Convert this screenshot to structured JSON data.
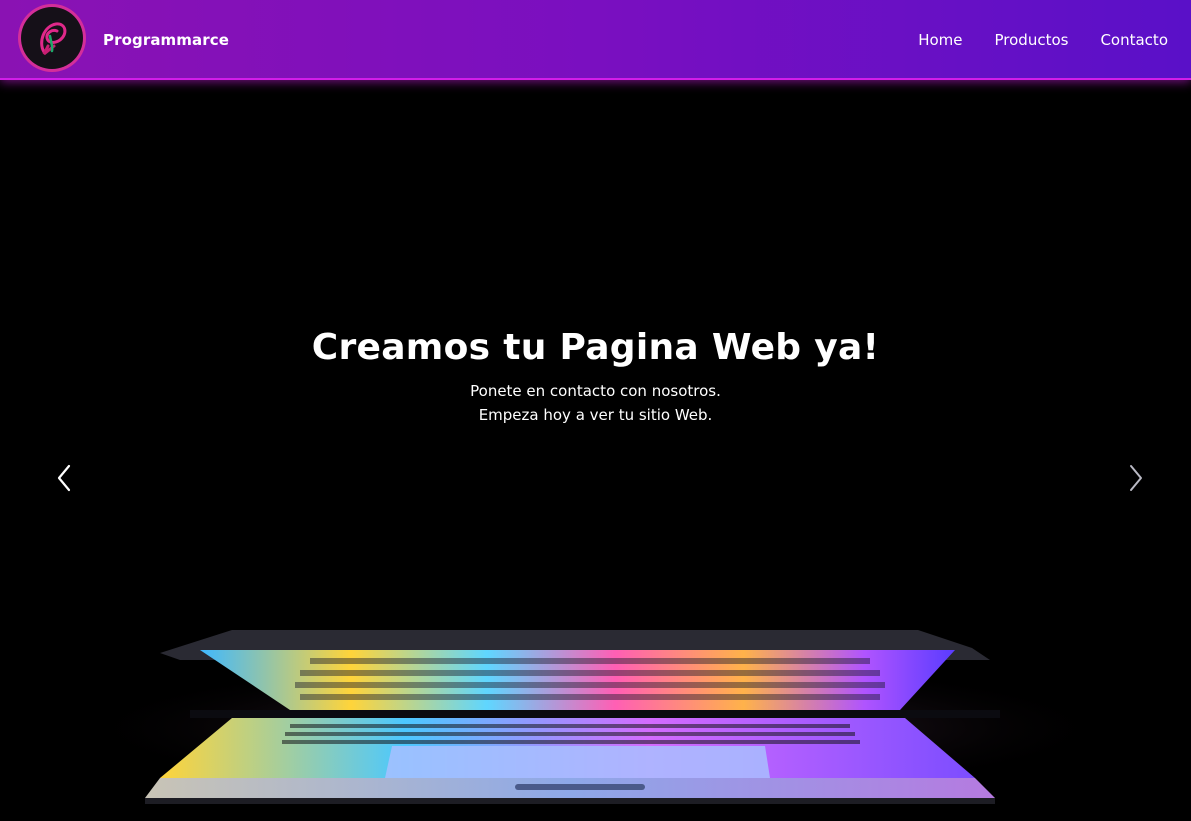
{
  "navbar": {
    "brand": "Programmarce",
    "links": [
      "Home",
      "Productos",
      "Contacto"
    ],
    "accent": "#d21ee8"
  },
  "hero": {
    "title": "Creamos tu Pagina Web ya!",
    "line1": "Ponete en contacto con nosotros.",
    "line2": "Empeza hoy a ver tu sitio Web."
  },
  "carousel": {
    "prev_icon": "chevron-left-icon",
    "next_icon": "chevron-right-icon"
  }
}
